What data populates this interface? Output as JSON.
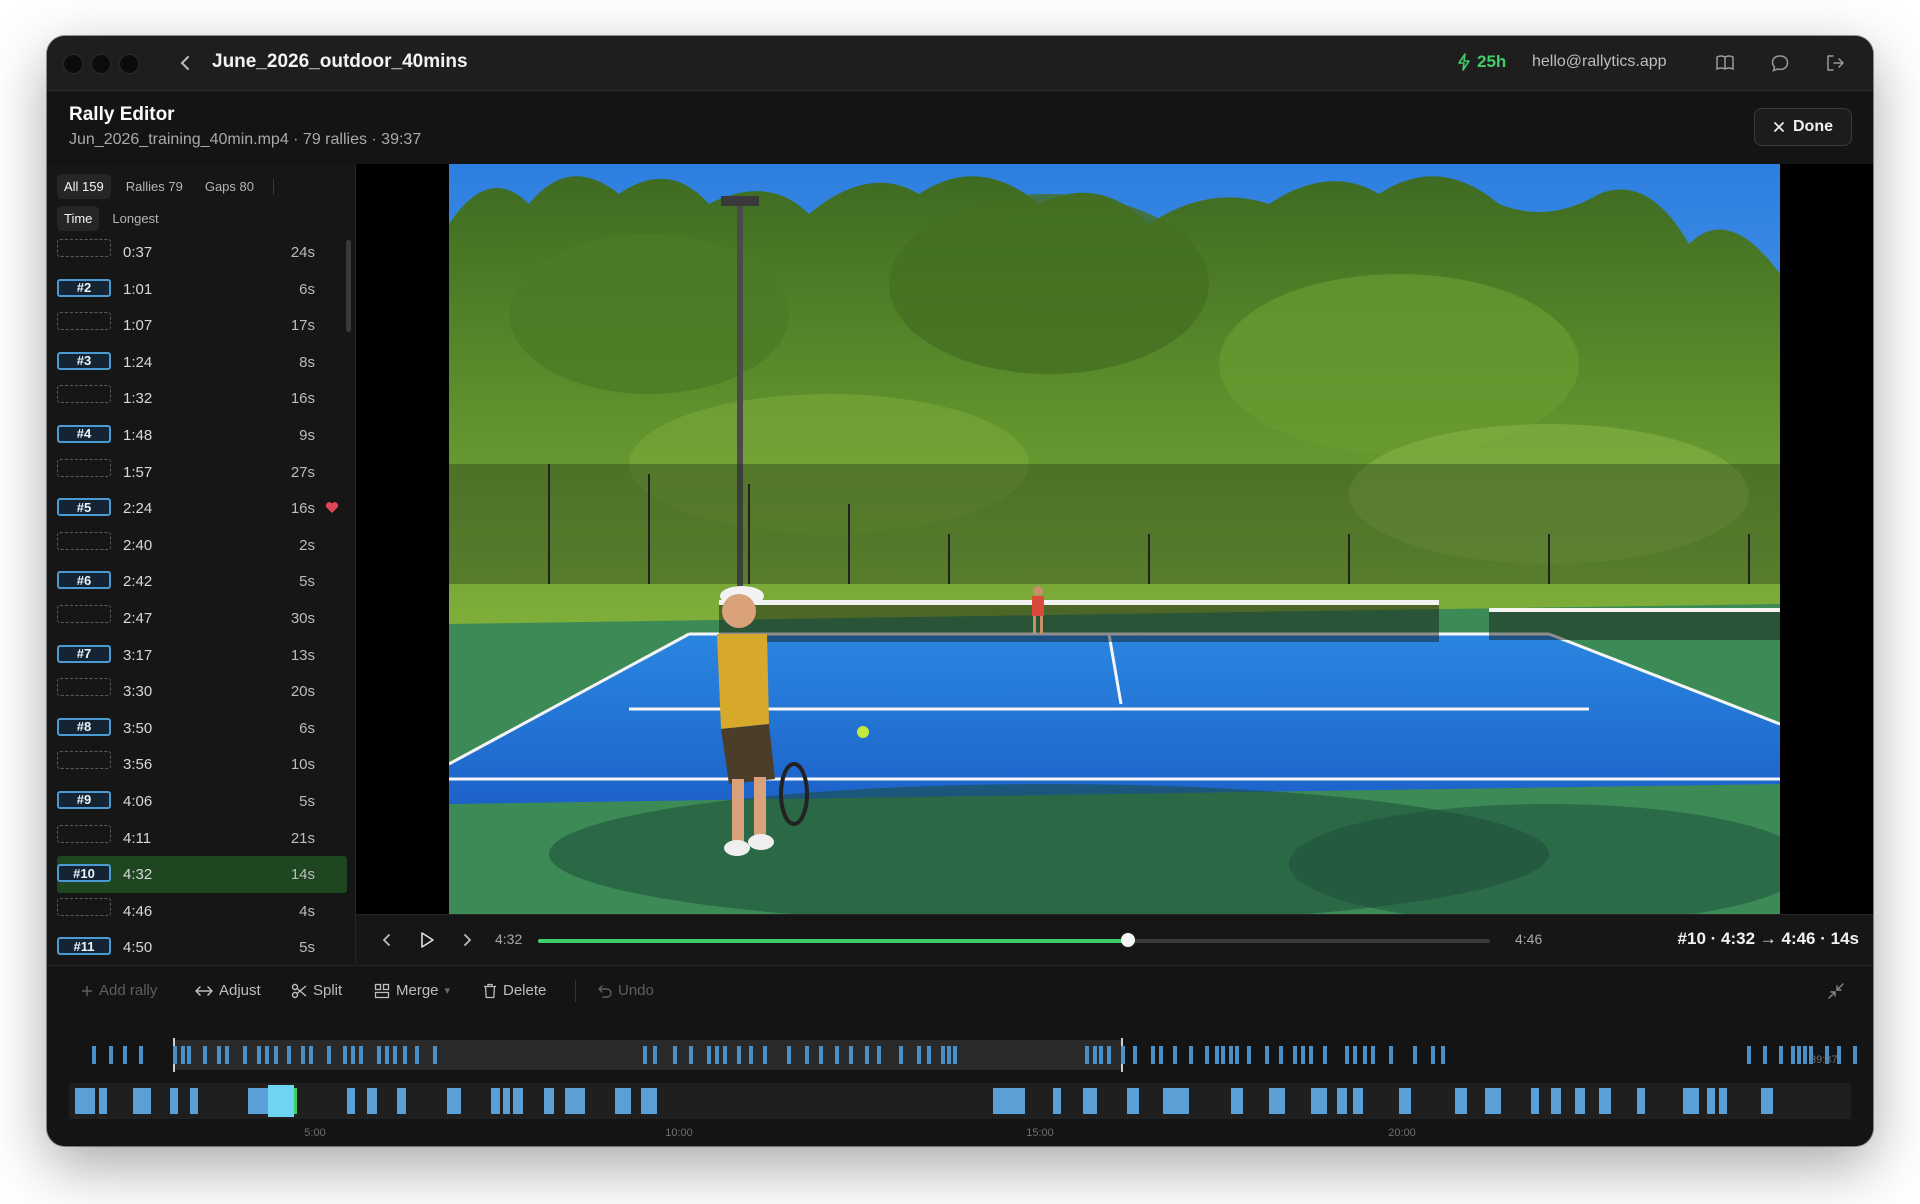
{
  "titlebar": {
    "title": "June_2026_outdoor_40mins",
    "credits": "25h",
    "email": "hello@rallytics.app"
  },
  "header": {
    "title": "Rally Editor",
    "subtitle": "Jun_2026_training_40min.mp4 · 79 rallies · 39:37",
    "done_label": "Done"
  },
  "filters": {
    "all": "All 159",
    "rallies": "Rallies 79",
    "gaps": "Gaps 80",
    "sort_time": "Time",
    "sort_longest": "Longest"
  },
  "clips": [
    {
      "type": "gap",
      "time": "0:37",
      "dur": "24s"
    },
    {
      "type": "rally",
      "label": "#2",
      "time": "1:01",
      "dur": "6s"
    },
    {
      "type": "gap",
      "time": "1:07",
      "dur": "17s"
    },
    {
      "type": "rally",
      "label": "#3",
      "time": "1:24",
      "dur": "8s"
    },
    {
      "type": "gap",
      "time": "1:32",
      "dur": "16s"
    },
    {
      "type": "rally",
      "label": "#4",
      "time": "1:48",
      "dur": "9s"
    },
    {
      "type": "gap",
      "time": "1:57",
      "dur": "27s"
    },
    {
      "type": "rally",
      "label": "#5",
      "time": "2:24",
      "dur": "16s",
      "favorite": true
    },
    {
      "type": "gap",
      "time": "2:40",
      "dur": "2s"
    },
    {
      "type": "rally",
      "label": "#6",
      "time": "2:42",
      "dur": "5s"
    },
    {
      "type": "gap",
      "time": "2:47",
      "dur": "30s"
    },
    {
      "type": "rally",
      "label": "#7",
      "time": "3:17",
      "dur": "13s"
    },
    {
      "type": "gap",
      "time": "3:30",
      "dur": "20s"
    },
    {
      "type": "rally",
      "label": "#8",
      "time": "3:50",
      "dur": "6s"
    },
    {
      "type": "gap",
      "time": "3:56",
      "dur": "10s"
    },
    {
      "type": "rally",
      "label": "#9",
      "time": "4:06",
      "dur": "5s"
    },
    {
      "type": "gap",
      "time": "4:11",
      "dur": "21s"
    },
    {
      "type": "rally",
      "label": "#10",
      "time": "4:32",
      "dur": "14s",
      "selected": true
    },
    {
      "type": "gap",
      "time": "4:46",
      "dur": "4s"
    },
    {
      "type": "rally",
      "label": "#11",
      "time": "4:50",
      "dur": "5s"
    }
  ],
  "playback": {
    "start": "4:32",
    "end": "4:46",
    "progress": 0.62,
    "info": "#10 · 4:32 → 4:46 · 14s"
  },
  "toolbar": {
    "add": "Add rally",
    "adjust": "Adjust",
    "split": "Split",
    "merge": "Merge",
    "delete": "Delete",
    "undo": "Undo"
  },
  "timeline": {
    "end_label": "39:37",
    "ticks": [
      "5:00",
      "10:00",
      "15:00",
      "20:00"
    ],
    "colors": {
      "rally": "#4a90c8",
      "selected": "#6fd3f2",
      "overview": "#5a9fd6"
    }
  },
  "colors": {
    "accent_green": "#3ecf68",
    "selected_row": "#1e4620",
    "badge_border": "#4a9bd3"
  }
}
